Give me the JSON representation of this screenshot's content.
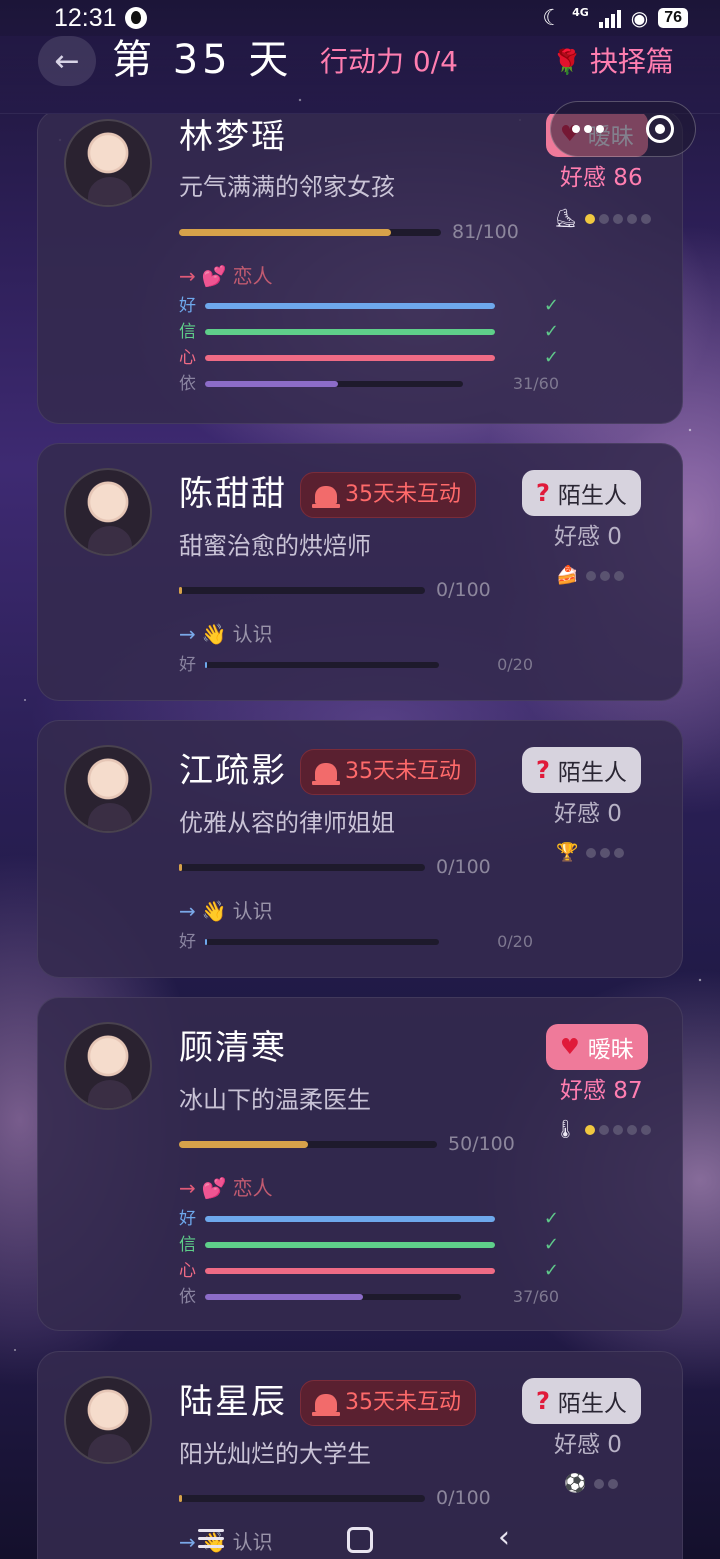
{
  "status_bar": {
    "time": "12:31",
    "network": "4G",
    "battery": "76",
    "icons": [
      "qq-icon",
      "moon-icon",
      "signal-icon",
      "wifi-icon",
      "battery-icon"
    ]
  },
  "header": {
    "back_icon": "arrow-left-icon",
    "day_title": "第 35 天",
    "action_points": "行动力 0/4",
    "chapter_icon": "rose-icon",
    "chapter_label": "抉择篇"
  },
  "capsule": {
    "icons": [
      "more-icon",
      "close-icon"
    ]
  },
  "colors": {
    "bar_gold": "#d7a24a",
    "stat_good": "#6ea8ec",
    "stat_trust": "#5fcf8a",
    "stat_heart": "#ef6b85",
    "stat_dep": "#8c6cc8",
    "accent_pink": "#ff7eb0",
    "alert_red": "#ff6a6a"
  },
  "characters": [
    {
      "name": "林梦瑶",
      "subtitle": "元气满满的邻家女孩",
      "alert": "",
      "badge": "暧昧",
      "badge_style": "pink",
      "affection": "好感 86",
      "item_icon": "ice-skate-icon",
      "item_glyph": "⛸",
      "dots_total": 5,
      "dots_on": 1,
      "progress_text": "81/100",
      "progress": 0.81,
      "goal": "恋人",
      "stats": [
        {
          "label": "好",
          "fill": 1.0,
          "done": true,
          "count": ""
        },
        {
          "label": "信",
          "fill": 1.0,
          "done": true,
          "count": ""
        },
        {
          "label": "心",
          "fill": 1.0,
          "done": true,
          "count": ""
        },
        {
          "label": "依",
          "fill": 0.5167,
          "done": false,
          "count": "31/60"
        }
      ]
    },
    {
      "name": "陈甜甜",
      "subtitle": "甜蜜治愈的烘焙师",
      "alert": "35天未互动",
      "badge": "陌生人",
      "badge_style": "gray",
      "affection": "好感 0",
      "item_icon": "cake-icon",
      "item_glyph": "🍰",
      "dots_total": 3,
      "dots_on": 0,
      "progress_text": "0/100",
      "progress": 0,
      "goal": "认识",
      "stats": [
        {
          "label": "好",
          "fill": 0,
          "done": false,
          "count": "0/20"
        }
      ]
    },
    {
      "name": "江疏影",
      "subtitle": "优雅从容的律师姐姐",
      "alert": "35天未互动",
      "badge": "陌生人",
      "badge_style": "gray",
      "affection": "好感 0",
      "item_icon": "trophy-icon",
      "item_glyph": "🏆",
      "dots_total": 3,
      "dots_on": 0,
      "progress_text": "0/100",
      "progress": 0,
      "goal": "认识",
      "stats": [
        {
          "label": "好",
          "fill": 0,
          "done": false,
          "count": "0/20"
        }
      ]
    },
    {
      "name": "顾清寒",
      "subtitle": "冰山下的温柔医生",
      "alert": "",
      "badge": "暧昧",
      "badge_style": "pink",
      "affection": "好感 87",
      "item_icon": "thermometer-icon",
      "item_glyph": "🌡",
      "dots_total": 5,
      "dots_on": 1,
      "progress_text": "50/100",
      "progress": 0.5,
      "goal": "恋人",
      "stats": [
        {
          "label": "好",
          "fill": 1.0,
          "done": true,
          "count": ""
        },
        {
          "label": "信",
          "fill": 1.0,
          "done": true,
          "count": ""
        },
        {
          "label": "心",
          "fill": 1.0,
          "done": true,
          "count": ""
        },
        {
          "label": "依",
          "fill": 0.6167,
          "done": false,
          "count": "37/60"
        }
      ]
    },
    {
      "name": "陆星辰",
      "subtitle": "阳光灿烂的大学生",
      "alert": "35天未互动",
      "badge": "陌生人",
      "badge_style": "gray",
      "affection": "好感 0",
      "item_icon": "soccer-ball-icon",
      "item_glyph": "⚽",
      "dots_total": 2,
      "dots_on": 0,
      "progress_text": "0/100",
      "progress": 0,
      "goal": "认识",
      "stats": []
    }
  ],
  "nav": {
    "icons": [
      "menu-icon",
      "home-icon",
      "back-icon"
    ]
  }
}
